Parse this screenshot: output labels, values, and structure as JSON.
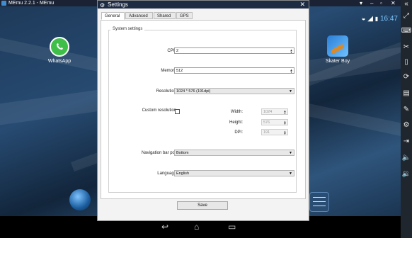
{
  "window": {
    "title": "MEmu 2.2.1 - MEmu"
  },
  "statusbar": {
    "time": "16:47"
  },
  "desktop": {
    "apps": [
      {
        "label": "WhatsApp"
      },
      {
        "label": "Skater Boy"
      }
    ]
  },
  "dialog": {
    "title": "Settings",
    "tabs": [
      {
        "label": "General"
      },
      {
        "label": "Advanced"
      },
      {
        "label": "Shared"
      },
      {
        "label": "GPS"
      }
    ],
    "group_title": "System settings",
    "fields": {
      "cpu": {
        "label": "CPU",
        "value": "2"
      },
      "memory": {
        "label": "Memory",
        "value": "512"
      },
      "resolution": {
        "label": "Resolution",
        "value": "1024 * 576 (191dpi)"
      },
      "custom_resolution": {
        "label": "Custom resolution",
        "checked": false
      },
      "width": {
        "label": "Width:",
        "value": "1024"
      },
      "height": {
        "label": "Height:",
        "value": "576"
      },
      "dpi": {
        "label": "DPI:",
        "value": "191"
      },
      "navbar_position": {
        "label": "Navigation bar position",
        "value": "Bottom"
      },
      "language": {
        "label": "Language",
        "value": "English"
      }
    },
    "save_label": "Save"
  },
  "colors": {
    "title_bar": "#1d2c43",
    "emulator_bg": "#1c2a3a",
    "clock": "#7ec8ff"
  }
}
